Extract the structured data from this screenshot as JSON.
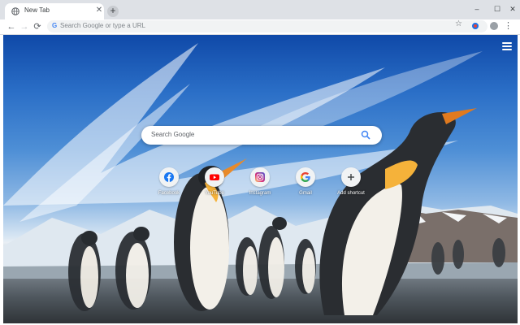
{
  "browser": {
    "tab": {
      "title": "New Tab",
      "favicon": "globe-icon"
    },
    "new_tab_symbol": "+",
    "window_controls": {
      "minimize": "–",
      "maximize": "☐",
      "close": "✕"
    },
    "toolbar": {
      "back_symbol": "←",
      "forward_symbol": "→",
      "reload_symbol": "⟳",
      "omnibox_placeholder": "Search Google or type a URL",
      "star_symbol": "☆",
      "menu_symbol": "⋮"
    }
  },
  "ntp": {
    "search_placeholder": "Search Google",
    "shortcuts": [
      {
        "label": "Facebook",
        "icon": "facebook-icon",
        "color": "#1877f2"
      },
      {
        "label": "YouTube",
        "icon": "youtube-icon",
        "color": "#ff0000"
      },
      {
        "label": "Instagram",
        "icon": "instagram-icon",
        "color": "#c13584"
      },
      {
        "label": "Gmail",
        "icon": "google-icon",
        "color": "#4285f4"
      },
      {
        "label": "Add shortcut",
        "icon": "plus-icon",
        "color": "#3c4043"
      }
    ],
    "background": "penguins"
  },
  "colors": {
    "tabstrip": "#dee1e6",
    "accent": "#1a73e8"
  }
}
